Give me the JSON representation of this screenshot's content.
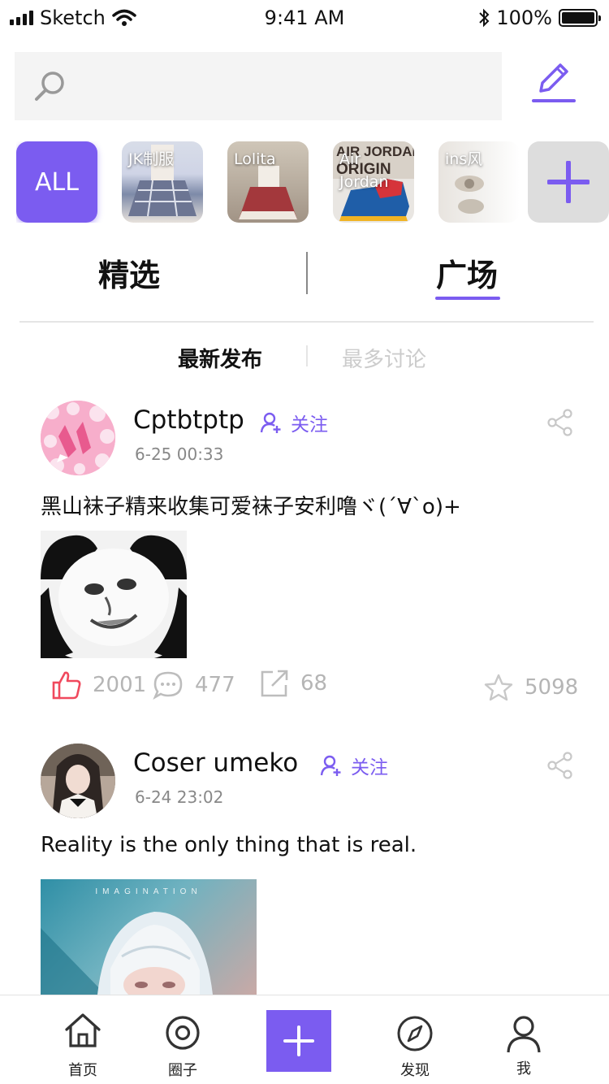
{
  "status_bar": {
    "carrier": "Sketch",
    "time": "9:41 AM",
    "battery": "100%"
  },
  "search": {
    "placeholder": ""
  },
  "categories": [
    {
      "label": "ALL"
    },
    {
      "label": "JK制服"
    },
    {
      "label": "Lolita"
    },
    {
      "label": "Air Jordan"
    },
    {
      "label": "ins风"
    }
  ],
  "tabs": {
    "featured": "精选",
    "plaza": "广场",
    "active": "广场"
  },
  "sub_tabs": {
    "latest": "最新发布",
    "discussed": "最多讨论",
    "active": "最新发布"
  },
  "posts": [
    {
      "username": "Cptbtptp",
      "follow_label": "关注",
      "time": "6-25 00:33",
      "text": "黑山袜子精来收集可爱袜子安利噜ヾ(´∀`o)+",
      "likes": "2001",
      "comments": "477",
      "shares": "68",
      "favorites": "5098",
      "accent_color": "#f0495d"
    },
    {
      "username": "Coser umeko",
      "follow_label": "关注",
      "time": "6-24 23:02",
      "text": "Reality is the only thing that is real.",
      "image_caption": "IMAGINATION"
    }
  ],
  "bottom_nav": {
    "home": "首页",
    "circle": "圈子",
    "discover": "发现",
    "me": "我"
  },
  "colors": {
    "accent": "#7b5cf0",
    "muted": "#b5b5b5"
  }
}
